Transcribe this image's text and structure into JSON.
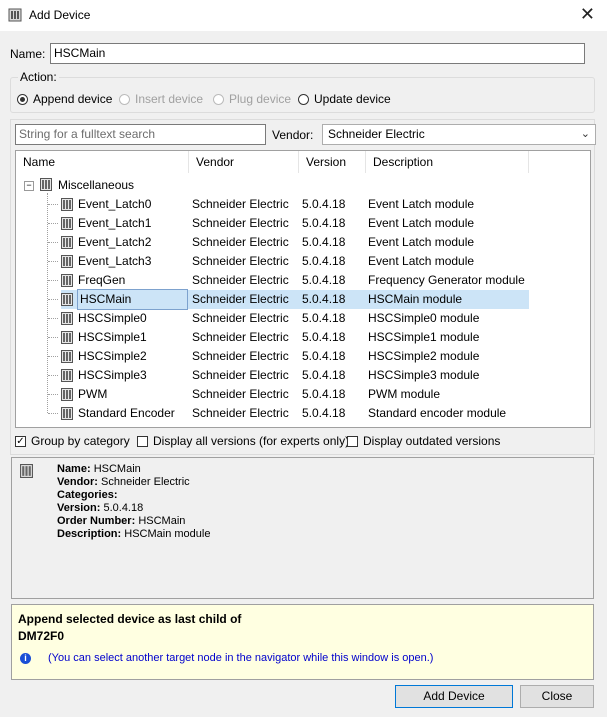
{
  "window": {
    "title": "Add Device",
    "icon": "device-icon",
    "close_icon": "close-icon"
  },
  "name_field": {
    "label": "Name:",
    "value": "HSCMain"
  },
  "action": {
    "legend": "Action:",
    "options": [
      {
        "label": "Append device",
        "selected": true,
        "enabled": true
      },
      {
        "label": "Insert device",
        "selected": false,
        "enabled": false
      },
      {
        "label": "Plug device",
        "selected": false,
        "enabled": false
      },
      {
        "label": "Update device",
        "selected": false,
        "enabled": true
      }
    ]
  },
  "search": {
    "placeholder": "String for a fulltext search",
    "value": ""
  },
  "vendor": {
    "label": "Vendor:",
    "selected": "Schneider Electric"
  },
  "table": {
    "columns": [
      "Name",
      "Vendor",
      "Version",
      "Description"
    ],
    "category": "Miscellaneous",
    "rows": [
      {
        "name": "Event_Latch0",
        "vendor": "Schneider Electric",
        "version": "5.0.4.18",
        "description": "Event Latch module",
        "selected": false
      },
      {
        "name": "Event_Latch1",
        "vendor": "Schneider Electric",
        "version": "5.0.4.18",
        "description": "Event Latch module",
        "selected": false
      },
      {
        "name": "Event_Latch2",
        "vendor": "Schneider Electric",
        "version": "5.0.4.18",
        "description": "Event Latch module",
        "selected": false
      },
      {
        "name": "Event_Latch3",
        "vendor": "Schneider Electric",
        "version": "5.0.4.18",
        "description": "Event Latch module",
        "selected": false
      },
      {
        "name": "FreqGen",
        "vendor": "Schneider Electric",
        "version": "5.0.4.18",
        "description": "Frequency Generator module",
        "selected": false
      },
      {
        "name": "HSCMain",
        "vendor": "Schneider Electric",
        "version": "5.0.4.18",
        "description": "HSCMain module",
        "selected": true
      },
      {
        "name": "HSCSimple0",
        "vendor": "Schneider Electric",
        "version": "5.0.4.18",
        "description": "HSCSimple0 module",
        "selected": false
      },
      {
        "name": "HSCSimple1",
        "vendor": "Schneider Electric",
        "version": "5.0.4.18",
        "description": "HSCSimple1 module",
        "selected": false
      },
      {
        "name": "HSCSimple2",
        "vendor": "Schneider Electric",
        "version": "5.0.4.18",
        "description": "HSCSimple2 module",
        "selected": false
      },
      {
        "name": "HSCSimple3",
        "vendor": "Schneider Electric",
        "version": "5.0.4.18",
        "description": "HSCSimple3 module",
        "selected": false
      },
      {
        "name": "PWM",
        "vendor": "Schneider Electric",
        "version": "5.0.4.18",
        "description": "PWM module",
        "selected": false
      },
      {
        "name": "Standard Encoder",
        "vendor": "Schneider Electric",
        "version": "5.0.4.18",
        "description": "Standard encoder module",
        "selected": false
      }
    ]
  },
  "options": {
    "group_by_category": {
      "label": "Group by category",
      "checked": true
    },
    "display_all_versions": {
      "label": "Display all versions (for experts only)",
      "checked": false
    },
    "display_outdated": {
      "label": "Display outdated versions",
      "checked": false
    }
  },
  "info": {
    "name_label": "Name:",
    "name_value": "HSCMain",
    "vendor_label": "Vendor:",
    "vendor_value": "Schneider Electric",
    "categories_label": "Categories:",
    "categories_value": "",
    "version_label": "Version:",
    "version_value": "5.0.4.18",
    "order_label": "Order Number:",
    "order_value": "HSCMain",
    "description_label": "Description:",
    "description_value": "HSCMain module"
  },
  "target": {
    "line1": "Append selected device as last child of",
    "line2": "DM72F0",
    "hint": "(You can select another target node in the navigator while this window is open.)"
  },
  "buttons": {
    "add": "Add Device",
    "close": "Close"
  },
  "colors": {
    "selection": "#cce4f7",
    "hint_text": "#0000cc",
    "target_bg": "#ffffe1"
  }
}
